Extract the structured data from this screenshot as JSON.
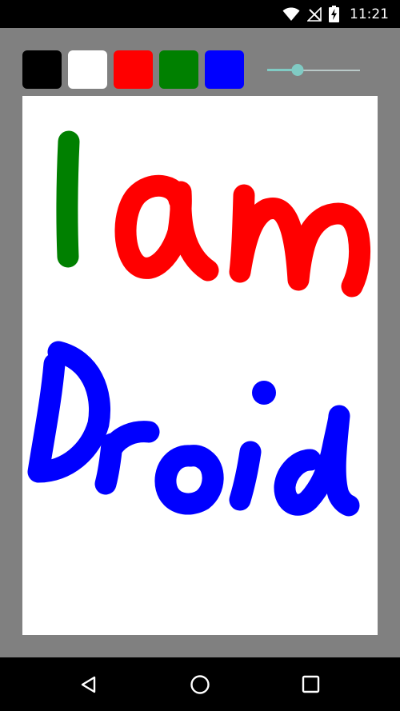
{
  "status_bar": {
    "time": "11:21",
    "icons": [
      "wifi-icon",
      "no-signal-icon",
      "battery-charging-icon"
    ]
  },
  "palette": {
    "colors": [
      {
        "name": "black",
        "hex": "#000000"
      },
      {
        "name": "white",
        "hex": "#ffffff"
      },
      {
        "name": "red",
        "hex": "#ff0000"
      },
      {
        "name": "green",
        "hex": "#008000"
      },
      {
        "name": "blue",
        "hex": "#0000ff"
      }
    ]
  },
  "brush_size_slider": {
    "value_fraction": 0.33,
    "accent": "#80cbc4"
  },
  "canvas": {
    "background": "#ffffff",
    "drawing": {
      "line1": "I am",
      "line2": "Droid"
    }
  },
  "nav_bar": {
    "buttons": [
      "back-icon",
      "home-icon",
      "recents-icon"
    ]
  }
}
